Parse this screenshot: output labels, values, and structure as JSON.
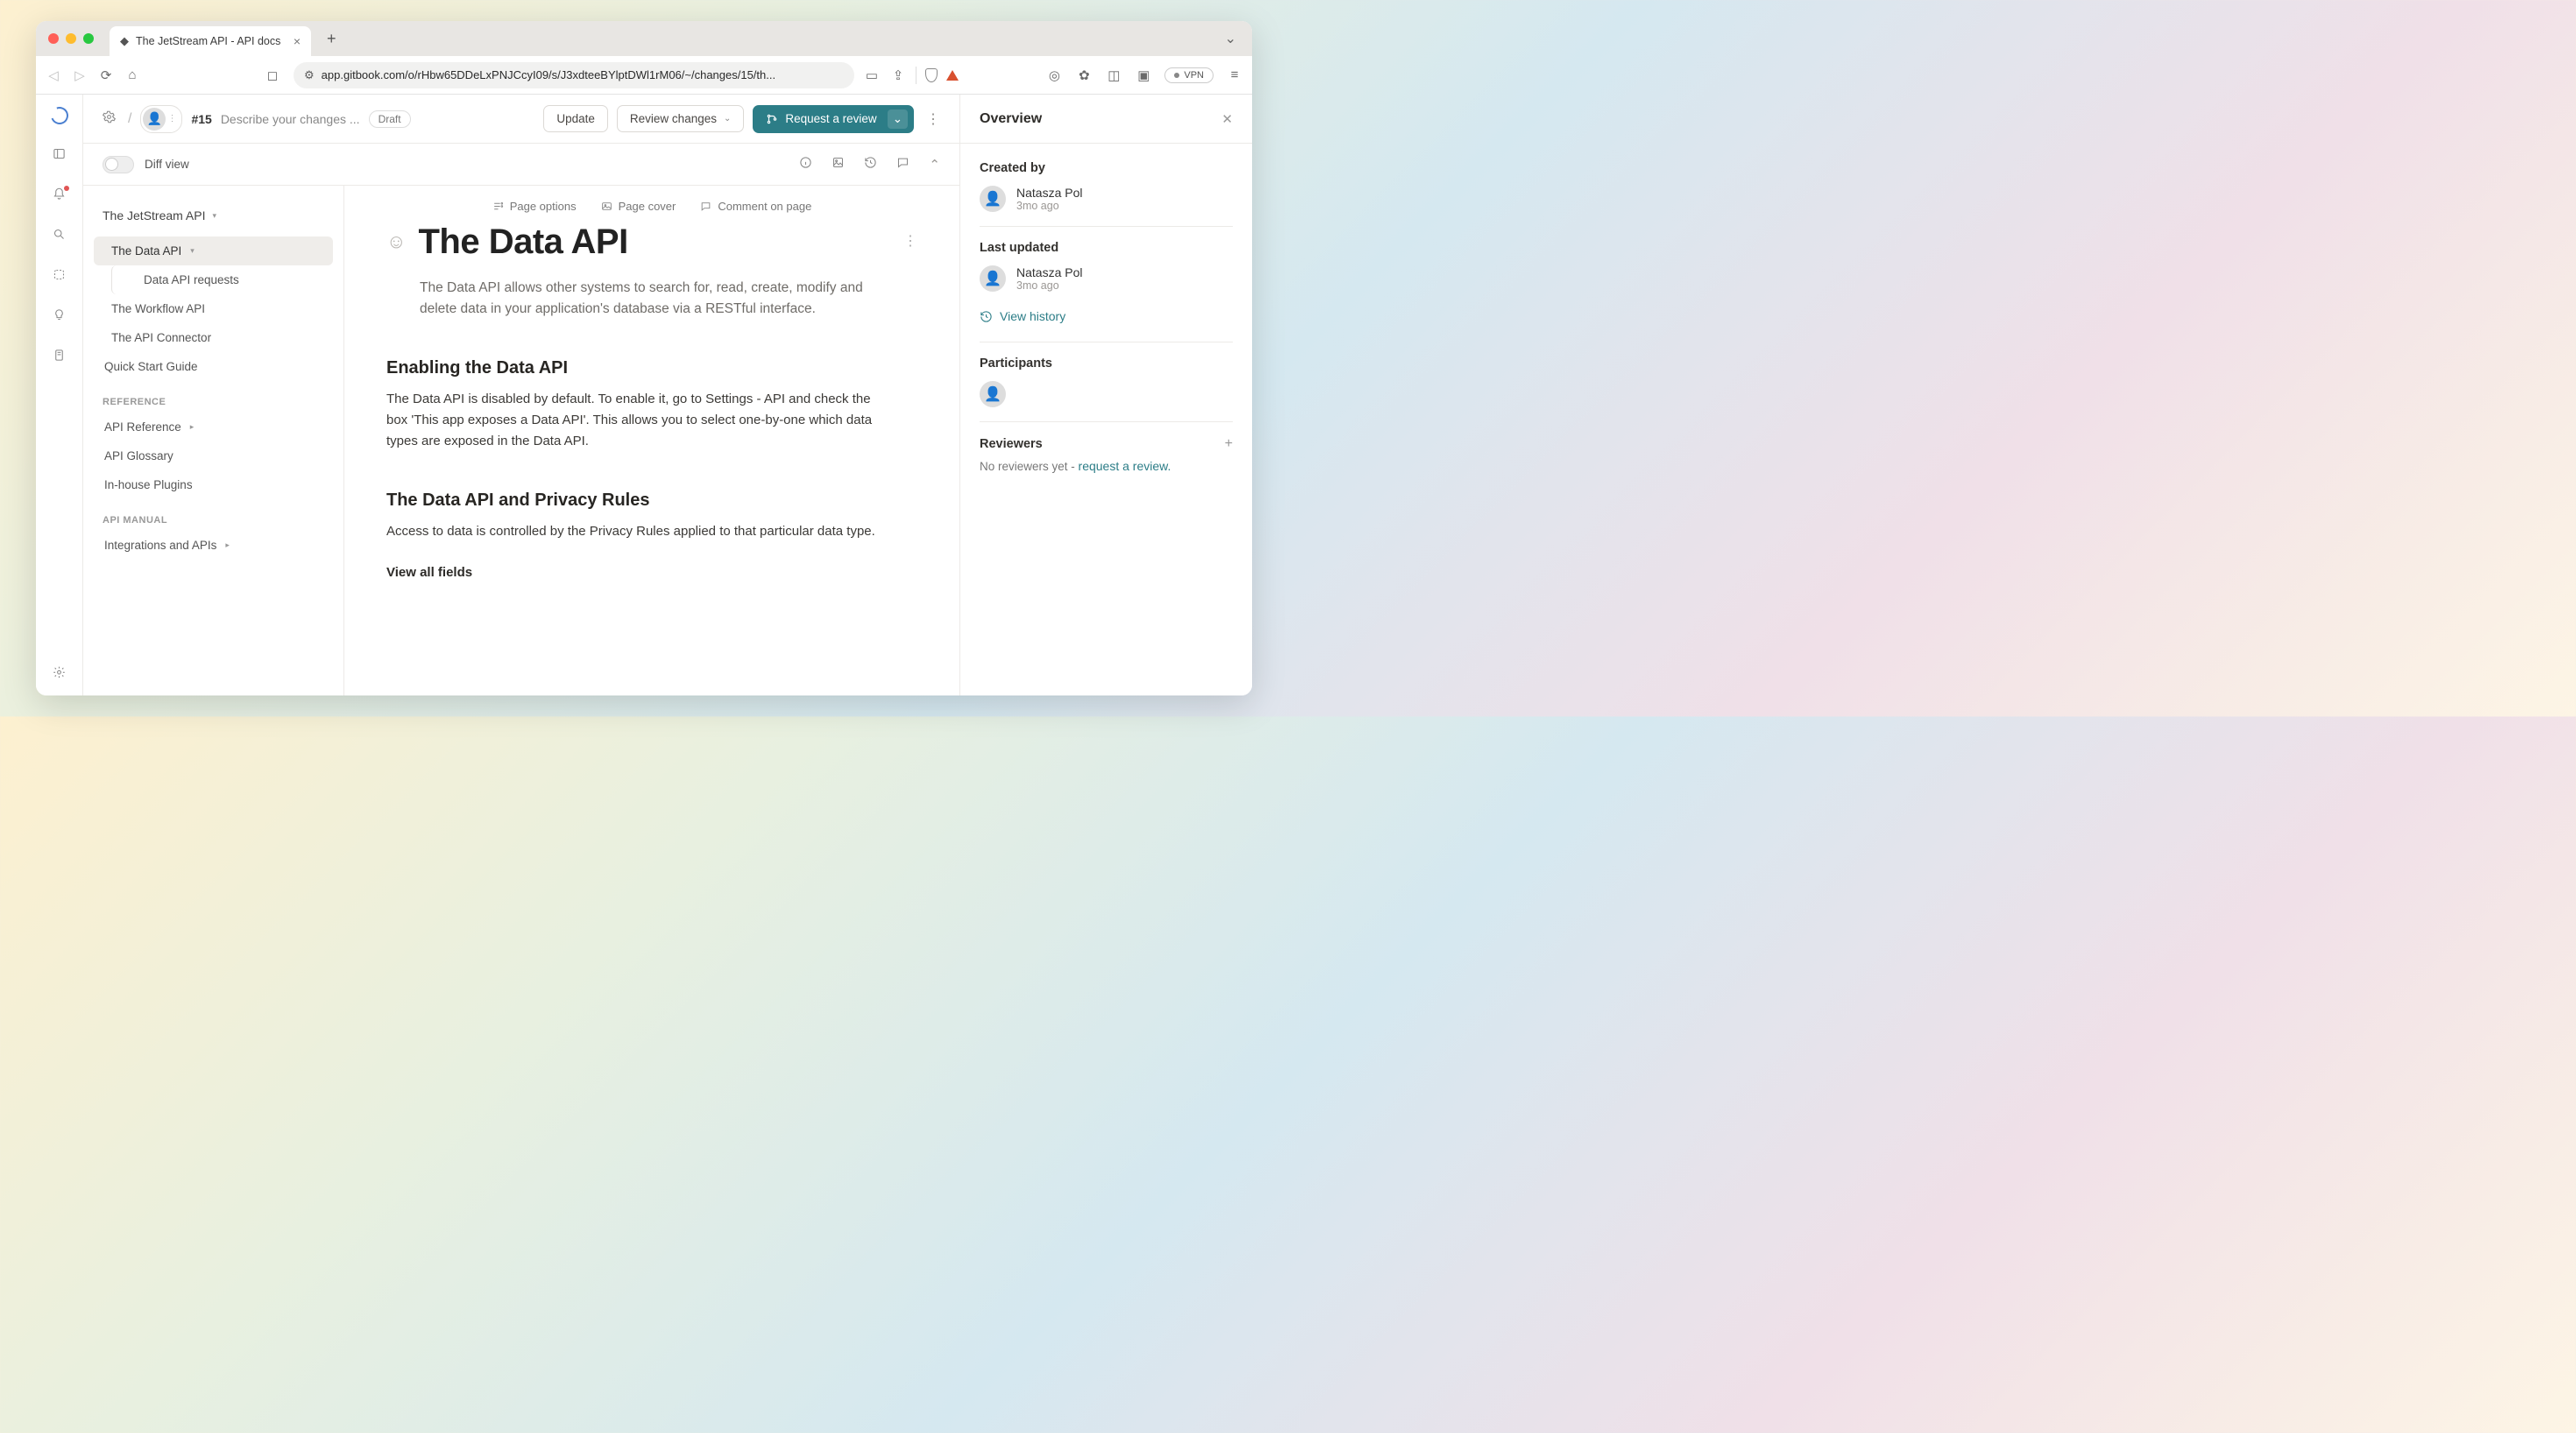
{
  "browser": {
    "tab_title": "The JetStream API - API docs",
    "url_display": "app.gitbook.com/o/rHbw65DDeLxPNJCcyI09/s/J3xdteeBYlptDWl1rM06/~/changes/15/th...",
    "vpn_label": "VPN"
  },
  "appbar": {
    "change_number": "#15",
    "change_desc": "Describe your changes ...",
    "draft_badge": "Draft",
    "update_btn": "Update",
    "review_btn": "Review changes",
    "request_btn": "Request a review"
  },
  "diffrow": {
    "label": "Diff view"
  },
  "nav": {
    "root": "The JetStream API",
    "items": [
      {
        "label": "The Data API",
        "active": true,
        "has_children": true
      },
      {
        "label": "Data API requests",
        "child": true
      },
      {
        "label": "The Workflow API"
      },
      {
        "label": "The API Connector"
      }
    ],
    "quick_start": "Quick Start Guide",
    "section_reference": "REFERENCE",
    "reference_items": [
      {
        "label": "API Reference",
        "caret": true
      },
      {
        "label": "API Glossary"
      },
      {
        "label": "In-house Plugins"
      }
    ],
    "section_manual": "API MANUAL",
    "manual_items": [
      {
        "label": "Integrations and APIs",
        "caret": true
      }
    ]
  },
  "page": {
    "actions": {
      "options": "Page options",
      "cover": "Page cover",
      "comment": "Comment on page"
    },
    "title": "The Data API",
    "desc": "The Data API allows other systems to search for, read, create, modify and delete data in your application's database via a RESTful interface.",
    "h2_1": "Enabling the Data API",
    "p_1": "The Data API is disabled by default. To enable it, go to Settings - API and check the box 'This app exposes a Data API'. This allows you to select one-by-one which data types are exposed in the Data API.",
    "h2_2": "The Data API and Privacy Rules",
    "p_2": "Access to data is controlled by the Privacy Rules applied to that particular data type.",
    "h3_1": "View all fields"
  },
  "overview": {
    "title": "Overview",
    "created_label": "Created by",
    "created_name": "Natasza Pol",
    "created_time": "3mo ago",
    "updated_label": "Last updated",
    "updated_name": "Natasza Pol",
    "updated_time": "3mo ago",
    "view_history": "View history",
    "participants_label": "Participants",
    "reviewers_label": "Reviewers",
    "no_reviewers_prefix": "No reviewers yet - ",
    "request_review_link": "request a review."
  }
}
